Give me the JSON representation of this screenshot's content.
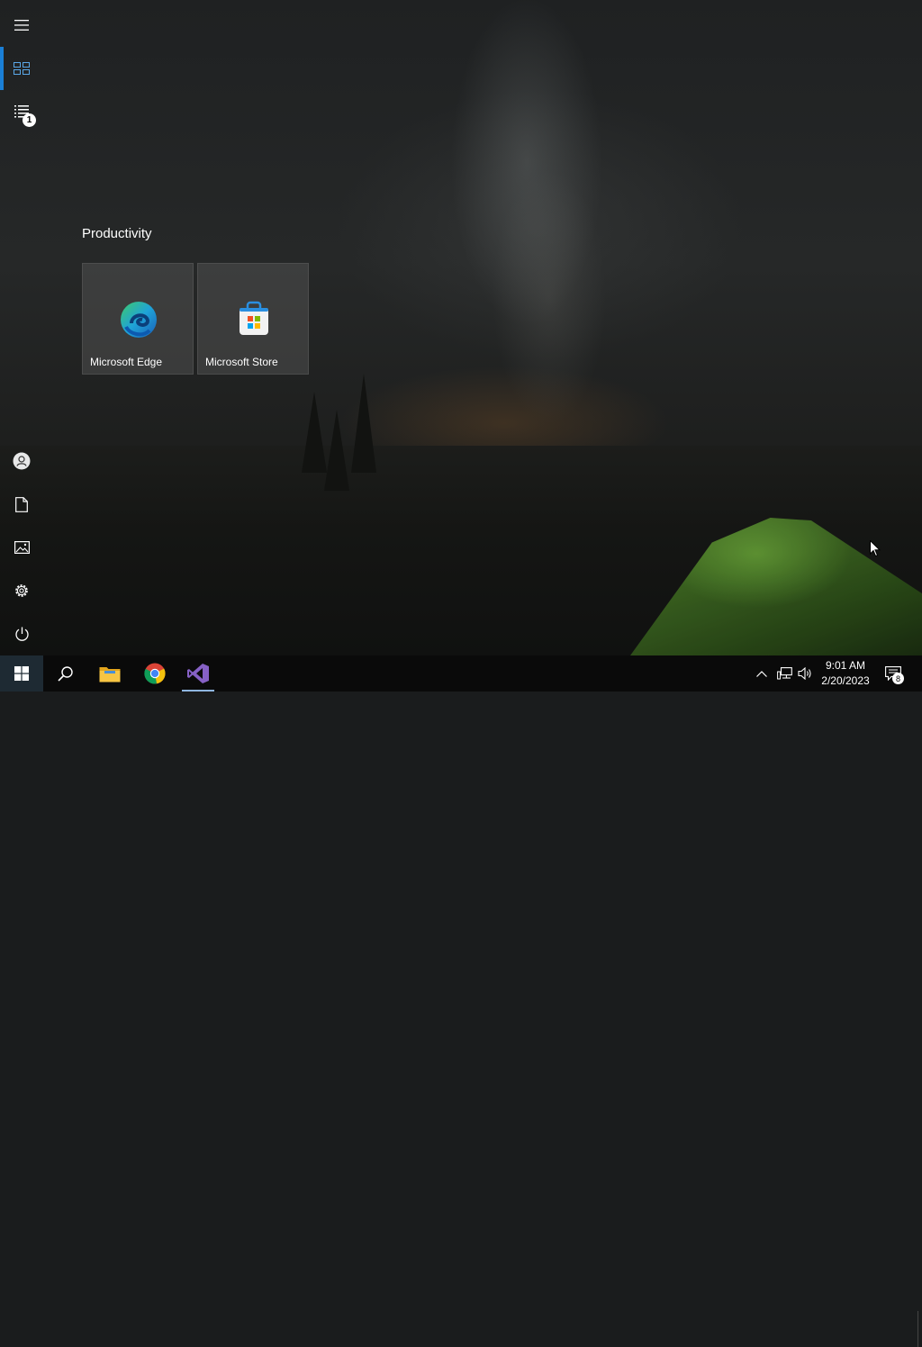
{
  "start_menu": {
    "rail": {
      "items": [
        {
          "name": "expand",
          "icon": "hamburger-icon"
        },
        {
          "name": "all-tiles",
          "icon": "tiles-icon",
          "active": true
        },
        {
          "name": "app-list",
          "icon": "list-icon",
          "badge": "1"
        },
        {
          "name": "account",
          "icon": "user-icon"
        },
        {
          "name": "documents",
          "icon": "document-icon"
        },
        {
          "name": "pictures",
          "icon": "pictures-icon"
        },
        {
          "name": "settings",
          "icon": "gear-icon"
        },
        {
          "name": "power",
          "icon": "power-icon"
        }
      ]
    },
    "group": {
      "title": "Productivity",
      "tiles": [
        {
          "label": "Microsoft Edge",
          "icon": "edge-icon"
        },
        {
          "label": "Microsoft Store",
          "icon": "store-icon"
        }
      ]
    }
  },
  "taskbar": {
    "buttons": [
      {
        "name": "start",
        "icon": "windows-logo-icon"
      },
      {
        "name": "search",
        "icon": "search-icon"
      },
      {
        "name": "file-explorer",
        "icon": "folder-icon"
      },
      {
        "name": "chrome",
        "icon": "chrome-icon"
      },
      {
        "name": "visual-studio",
        "icon": "visual-studio-icon"
      }
    ],
    "tray": {
      "time": "9:01 AM",
      "date": "2/20/2023",
      "notification_count": "8",
      "icons": [
        "chevron-up-icon",
        "network-icon",
        "volume-icon",
        "action-center-icon"
      ]
    }
  },
  "colors": {
    "accent": "#1a7fd6",
    "taskbar": "#0a0a0a",
    "tent_green": "#4f7f2a"
  }
}
